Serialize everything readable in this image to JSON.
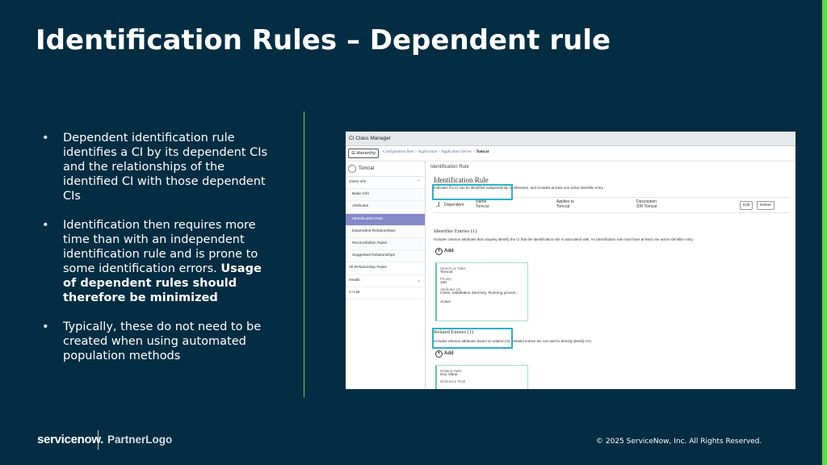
{
  "slide": {
    "title": "Identification Rules – Dependent rule",
    "bullets": [
      {
        "text": "Dependent identification rule identifies a CI by its dependent CIs and the relationships of the identified CI with those dependent CIs",
        "bold": ""
      },
      {
        "text": "Identification then requires more time than with an independent identification rule and is prone to some identification errors. ",
        "bold": "Usage of dependent rules should therefore be minimized"
      },
      {
        "text": "Typically, these do not need to be created when using automated population methods",
        "bold": ""
      }
    ],
    "bullet_char": "•",
    "footer": {
      "logo": "servicenow.",
      "partner": "PartnerLogo",
      "copyright": "© 2025 ServiceNow, Inc. All Rights Reserved."
    },
    "colors": {
      "background": "#032d42",
      "accent": "#62d84e",
      "highlight": "#2bb3c0"
    }
  },
  "screenshot": {
    "window_title": "CI Class Manager",
    "hierarchy_button": "Hierarchy",
    "breadcrumb": [
      "Configuration Item",
      "Application",
      "Application Server"
    ],
    "breadcrumb_current": "Tomcat",
    "sidebar": {
      "ci_name": "Tomcat",
      "items": [
        {
          "label": "Class Info",
          "sub": false,
          "active": false,
          "chevron": "^"
        },
        {
          "label": "Basic Info",
          "sub": true,
          "active": false,
          "chevron": ""
        },
        {
          "label": "Attributes",
          "sub": true,
          "active": false,
          "chevron": ""
        },
        {
          "label": "Identification Rule",
          "sub": true,
          "active": true,
          "chevron": ""
        },
        {
          "label": "Dependent Relationships",
          "sub": true,
          "active": false,
          "chevron": ""
        },
        {
          "label": "Reconciliation Rules",
          "sub": true,
          "active": false,
          "chevron": ""
        },
        {
          "label": "Suggested Relationships",
          "sub": true,
          "active": false,
          "chevron": ""
        },
        {
          "label": "All Relationship Rules",
          "sub": false,
          "active": false,
          "chevron": ""
        },
        {
          "label": "Health",
          "sub": false,
          "active": false,
          "chevron": "v"
        },
        {
          "label": "CI List",
          "sub": false,
          "active": false,
          "chevron": ""
        }
      ]
    },
    "main": {
      "header": "Identification Rule",
      "rule_title": "Identification Rule",
      "rule_desc": "Indicates if a CI can be identified independently or otherwise, and includes at least one active identifier entry.",
      "rule_type": "Dependent",
      "name_label": "Name",
      "name_value": "Tomcat",
      "applies_label": "Applies to",
      "applies_value": "Tomcat",
      "description_label": "Description",
      "description_value": "SW Tomcat",
      "edit": "Edit",
      "delete": "Delete",
      "identifier_title": "Identifier Entries (1)",
      "identifier_desc": "Includes criterion attributes that uniquely identify the CI that the identification rule is associated with. An identification rule must have at least one active identifier entry.",
      "add": "Add",
      "identifier_card": {
        "search_label": "Search on Table",
        "search_value": "Tomcat",
        "priority_label": "Priority",
        "priority_value": "100",
        "attributes_label": "Attributes (3)",
        "attributes_value": "Class, Installation directory, Running proces...",
        "status": "Active"
      },
      "related_title": "Related Entries (1)",
      "related_desc": "Includes criterion attributes based on related CIs. Related entries are not used to directly identify CIs.",
      "related_card": {
        "table_label": "Related Table",
        "table_value": "Key Value",
        "ref_label": "Reference Field"
      }
    }
  }
}
